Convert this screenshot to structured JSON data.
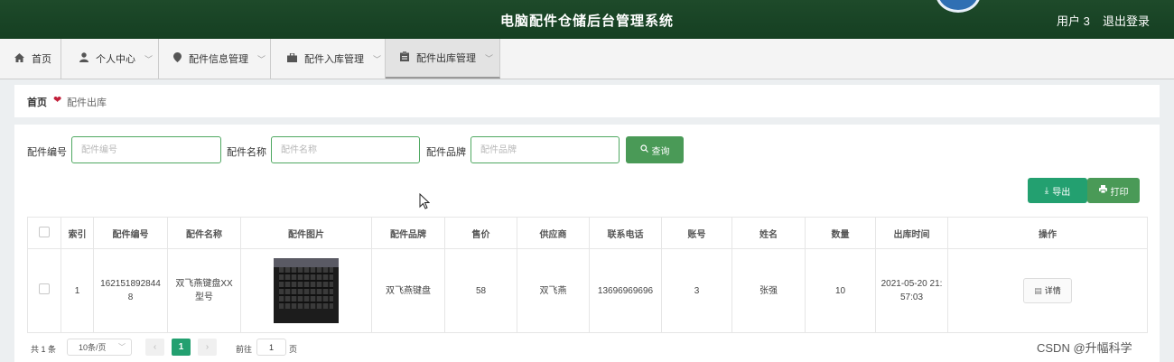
{
  "header": {
    "title": "电脑配件仓储后台管理系统",
    "user": "用户 3",
    "logout": "退出登录"
  },
  "nav": [
    {
      "label": "首页",
      "icon": "home-icon"
    },
    {
      "label": "个人中心",
      "icon": "person-icon"
    },
    {
      "label": "配件信息管理",
      "icon": "pin-icon"
    },
    {
      "label": "配件入库管理",
      "icon": "briefcase-icon"
    },
    {
      "label": "配件出库管理",
      "icon": "clipboard-icon"
    }
  ],
  "breadcrumb": {
    "home": "首页",
    "current": "配件出库"
  },
  "filters": {
    "code": {
      "label": "配件编号",
      "placeholder": "配件编号"
    },
    "name": {
      "label": "配件名称",
      "placeholder": "配件名称"
    },
    "brand": {
      "label": "配件品牌",
      "placeholder": "配件品牌"
    },
    "search": "查询"
  },
  "actions": {
    "export": "导出",
    "print": "打印"
  },
  "table": {
    "headers": [
      "索引",
      "配件编号",
      "配件名称",
      "配件图片",
      "配件品牌",
      "售价",
      "供应商",
      "联系电话",
      "账号",
      "姓名",
      "数量",
      "出库时间",
      "操作"
    ],
    "rows": [
      {
        "index": "1",
        "code": "1621518928448",
        "name": "双飞燕键盘XX型号",
        "brand": "双飞燕键盘",
        "price": "58",
        "supplier": "双飞燕",
        "phone": "13696969696",
        "account": "3",
        "person": "张强",
        "qty": "10",
        "time": "2021-05-20 21:57:03",
        "action": "详情"
      }
    ]
  },
  "pagination": {
    "total": "共 1 条",
    "page_size": "10条/页",
    "current": "1",
    "goto_label": "前往",
    "goto_value": "1",
    "page_suffix": "页"
  },
  "watermark": "CSDN @升幅科学",
  "colors": {
    "header_bg": "#1a4425",
    "primary_green": "#4fa861",
    "teal": "#23a070"
  }
}
